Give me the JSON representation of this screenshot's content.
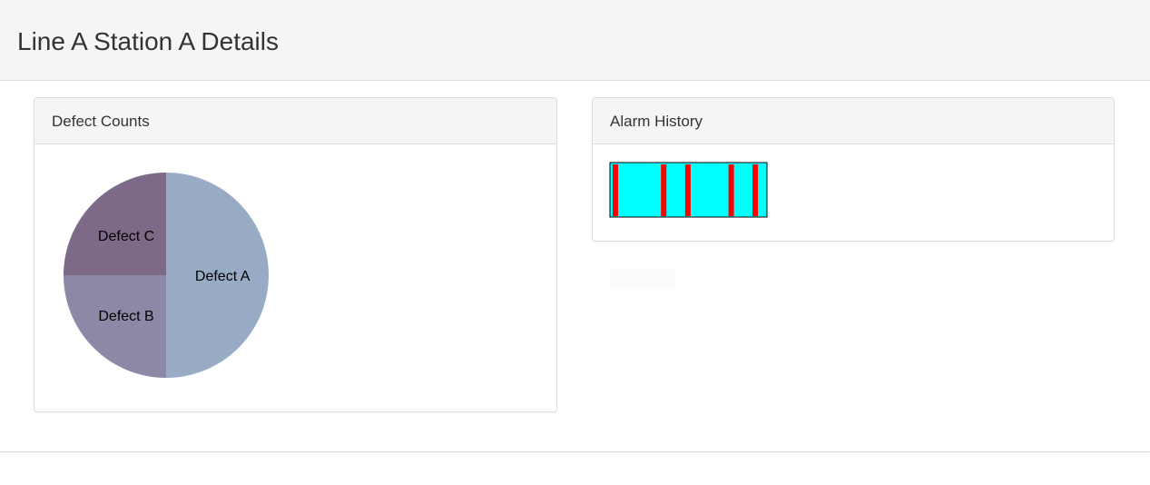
{
  "page": {
    "title": "Line A Station A Details"
  },
  "defect_panel": {
    "title": "Defect Counts"
  },
  "alarm_panel": {
    "title": "Alarm History"
  },
  "colors": {
    "defect_a": "#97abc5",
    "defect_b": "#8c89a6",
    "defect_c": "#7d6a89",
    "alarm_normal": "#00ffff",
    "alarm_active": "#ff0000"
  },
  "chart_data": [
    {
      "type": "pie",
      "labels": [
        "Defect A",
        "Defect B",
        "Defect C"
      ],
      "values": [
        50,
        25,
        25
      ],
      "colors": [
        "#97abc5",
        "#8c89a6",
        "#7d6a89"
      ]
    },
    {
      "type": "timeline",
      "range": [
        0,
        100
      ],
      "background_color": "#00ffff",
      "event_color": "#ff0000",
      "events": [
        1.7,
        32.5,
        47.9,
        75.5,
        90.8
      ]
    }
  ]
}
